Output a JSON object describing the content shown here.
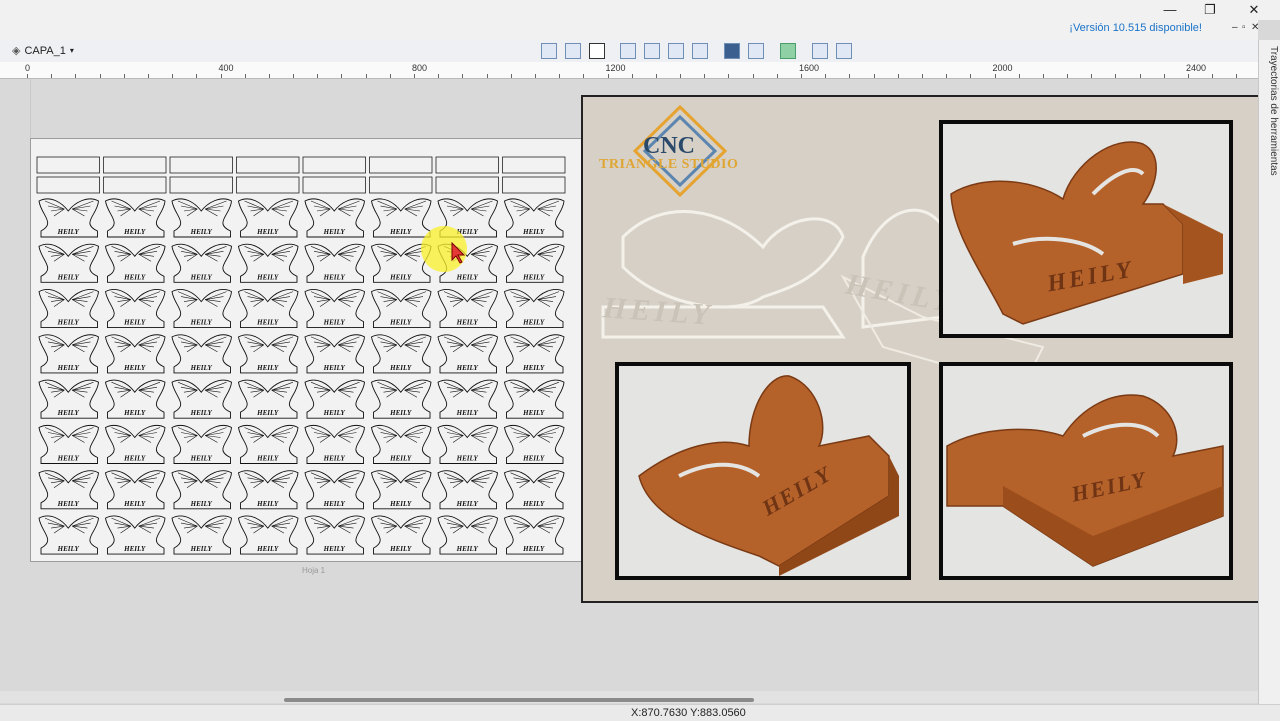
{
  "app": {
    "version_notice": "¡Versión 10.515 disponible!"
  },
  "toolbar": {
    "layer_name": "CAPA_1",
    "tools": [
      "align-icon",
      "image-icon",
      "grid-icon",
      "move-icon",
      "zoom-in-icon",
      "zoom-fit-icon",
      "zoom-out-icon",
      "node-edit-icon",
      "mirror-icon",
      "material-icon",
      "layout-icon",
      "panel-icon"
    ]
  },
  "ruler": {
    "labels": [
      "0",
      "400",
      "800",
      "1200",
      "1600",
      "2000",
      "2400"
    ]
  },
  "sheet": {
    "label": "Hoja 1",
    "grid_columns": 8,
    "grid_rows": 8,
    "piece_text": "HEILY"
  },
  "status": {
    "coords": "X:870.7630 Y:883.0560"
  },
  "right_panel": {
    "tab_label": "Trayectorias de herramientas"
  },
  "overlay": {
    "logo_main": "CNC",
    "logo_sub": "TRIANGLE STUDIO",
    "engraving": "HEILY",
    "colors": {
      "wood": "#b5612a",
      "frame": "#0b0b0b"
    }
  }
}
